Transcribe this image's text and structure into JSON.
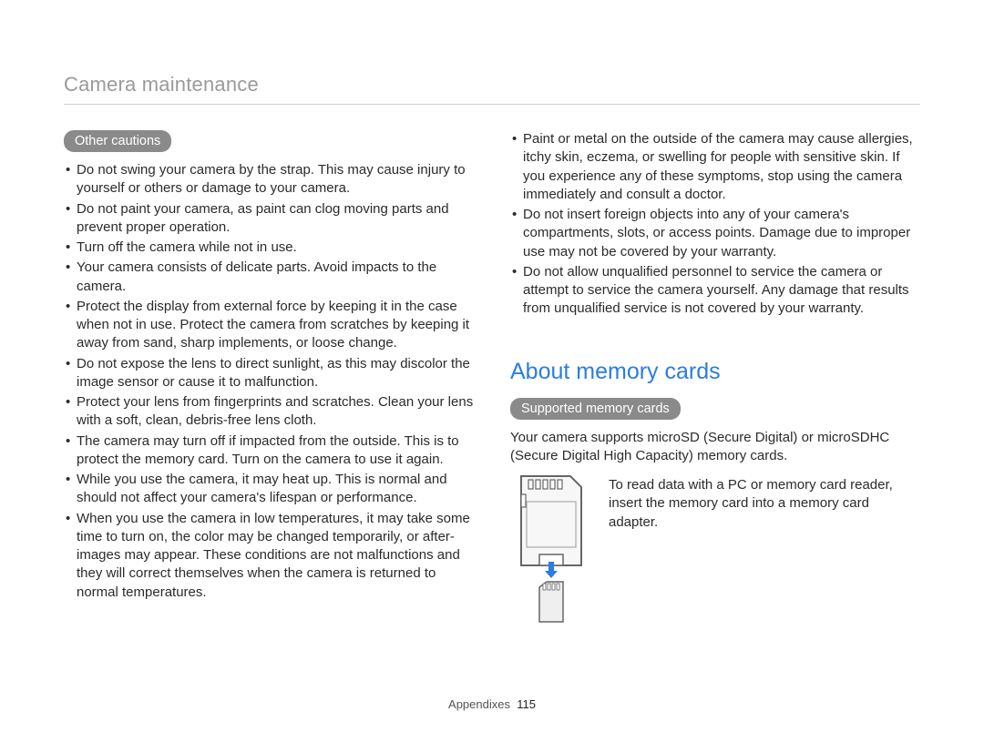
{
  "header": {
    "title": "Camera maintenance"
  },
  "left": {
    "pill": "Other cautions",
    "bullets": [
      "Do not swing your camera by the strap. This may cause injury to yourself or others or damage to your camera.",
      "Do not paint your camera, as paint can clog moving parts and prevent proper operation.",
      "Turn off the camera while not in use.",
      "Your camera consists of delicate parts. Avoid impacts to the camera.",
      "Protect the display from external force by keeping it in the case when not in use. Protect the camera from scratches by keeping it away from sand, sharp implements, or loose change.",
      "Do not expose the lens to direct sunlight, as this may discolor the image sensor or cause it to malfunction.",
      "Protect your lens from fingerprints and scratches. Clean your lens with a soft, clean, debris-free lens cloth.",
      "The camera may turn off if impacted from the outside. This is to protect the memory card. Turn on the camera to use it again.",
      "While you use the camera, it may heat up. This is normal and should not affect your camera's lifespan or performance.",
      "When you use the camera in low temperatures, it may take some time to turn on, the color may be changed temporarily, or after-images may appear. These conditions are not malfunctions and they will correct themselves when the camera is returned to normal temperatures."
    ]
  },
  "right": {
    "top_bullets": [
      "Paint or metal on the outside of the camera may cause allergies, itchy skin, eczema, or swelling for people with sensitive skin. If you experience any of these symptoms, stop using the camera immediately and consult a doctor.",
      "Do not insert foreign objects into any of your camera's compartments, slots, or access points. Damage due to improper use may not be covered by your warranty.",
      "Do not allow unqualified personnel to service the camera or attempt to service the camera yourself. Any damage that results from unqualified service is not covered by your warranty."
    ],
    "section_heading": "About memory cards",
    "pill": "Supported memory cards",
    "body": "Your camera supports microSD (Secure Digital) or microSDHC (Secure Digital High Capacity) memory cards.",
    "note": "To read data with a PC or memory card reader, insert the memory card into a memory card adapter."
  },
  "footer": {
    "section": "Appendixes",
    "page": "115"
  },
  "icons": {
    "sd_adapter": "sd-card-adapter-icon",
    "micro_sd": "micro-sd-card-icon",
    "arrow_up": "arrow-up-icon"
  }
}
